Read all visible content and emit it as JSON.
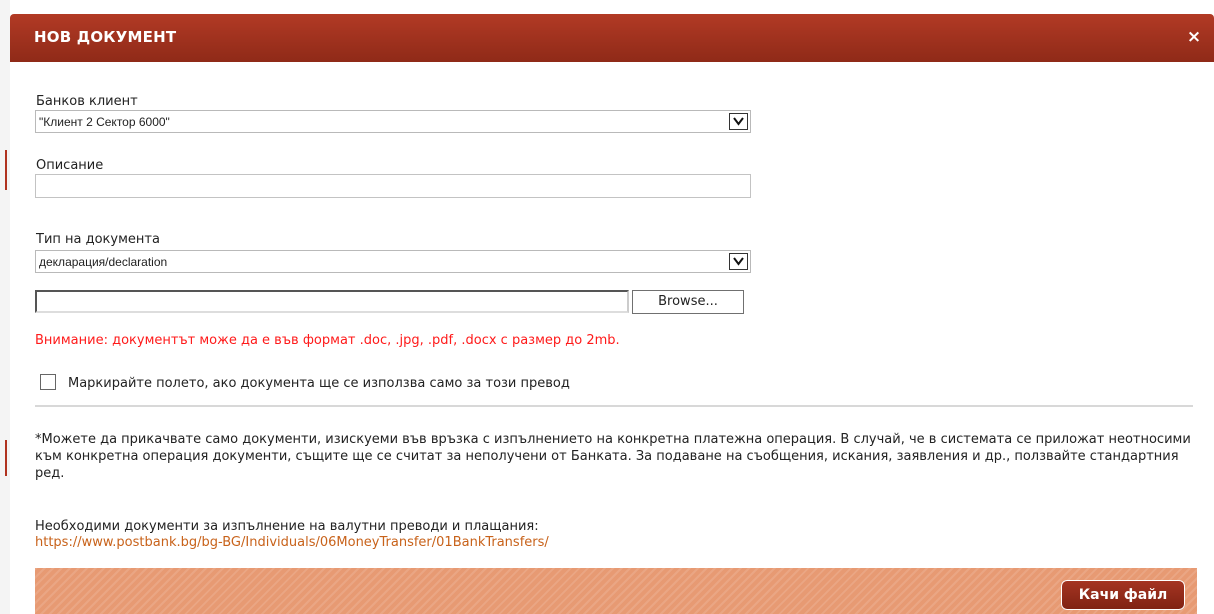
{
  "dialog": {
    "title": "НОВ ДОКУМЕНТ",
    "close_symbol": "×"
  },
  "bank_client": {
    "label": "Банков клиент",
    "selected": "\"Клиент 2 Сектор 6000\""
  },
  "description": {
    "label": "Описание",
    "value": ""
  },
  "document_type": {
    "label": "Тип на документа",
    "selected": "декларация/declaration"
  },
  "file": {
    "value": "",
    "browse_label": "Browse..."
  },
  "warning_text": "Внимание: документът може да е във формат .doc, .jpg, .pdf, .docx с размер до 2mb.",
  "checkbox": {
    "label": "Маркирайте полето, ако документа ще се използва само за този превод",
    "checked": false
  },
  "note_text": "*Можете да прикачвате само документи, изискуеми във връзка с изпълнението на конкретна платежна операция. В случай, че в системата се приложат неотносими към конкретна операция документи, същите ще се считат за неполучени от Банката. За подаване на съобщения, искания, заявления и др., ползвайте стандартния ред.",
  "required_docs": {
    "text": "Необходими документи за изпълнение на валутни преводи и плащания:",
    "link": "https://www.postbank.bg/bg-BG/Individuals/06MoneyTransfer/01BankTransfers/"
  },
  "footer": {
    "upload_label": "Качи файл"
  },
  "colors": {
    "titlebar": "#9f3220",
    "warning": "#ff1a1a",
    "link": "#c8621a",
    "footer": "#e79a73"
  }
}
